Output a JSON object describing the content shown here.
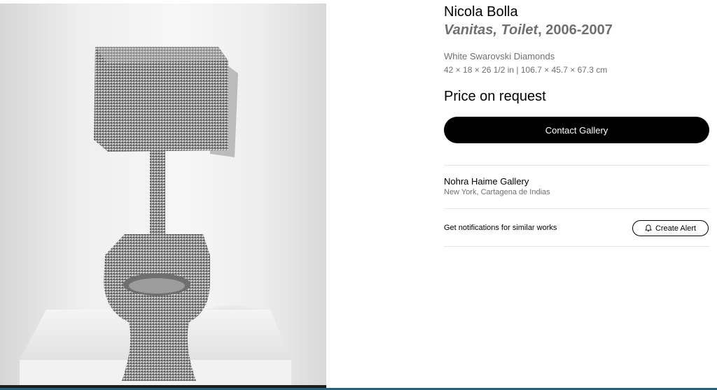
{
  "artwork": {
    "image_icon": "artwork-photo",
    "artist": "Nicola Bolla",
    "title": "Vanitas, Toilet",
    "title_separator": ",",
    "year": " 2006-2007",
    "medium": "White Swarovski Diamonds",
    "dimensions": "42 × 18 × 26 1/2 in | 106.7 × 45.7 × 67.3 cm",
    "price": "Price on request"
  },
  "actions": {
    "contact_label": "Contact Gallery"
  },
  "gallery": {
    "name": "Nohra Haime Gallery",
    "location": "New York, Cartagena de Indias"
  },
  "alerts": {
    "prompt": "Get notifications for similar works",
    "button_label": "Create Alert",
    "button_icon": "bell-icon"
  },
  "colors": {
    "button_bg": "#000000",
    "muted_text": "#707070",
    "divider": "#e5e5e5",
    "bottom_bar": "#2a5f78"
  }
}
